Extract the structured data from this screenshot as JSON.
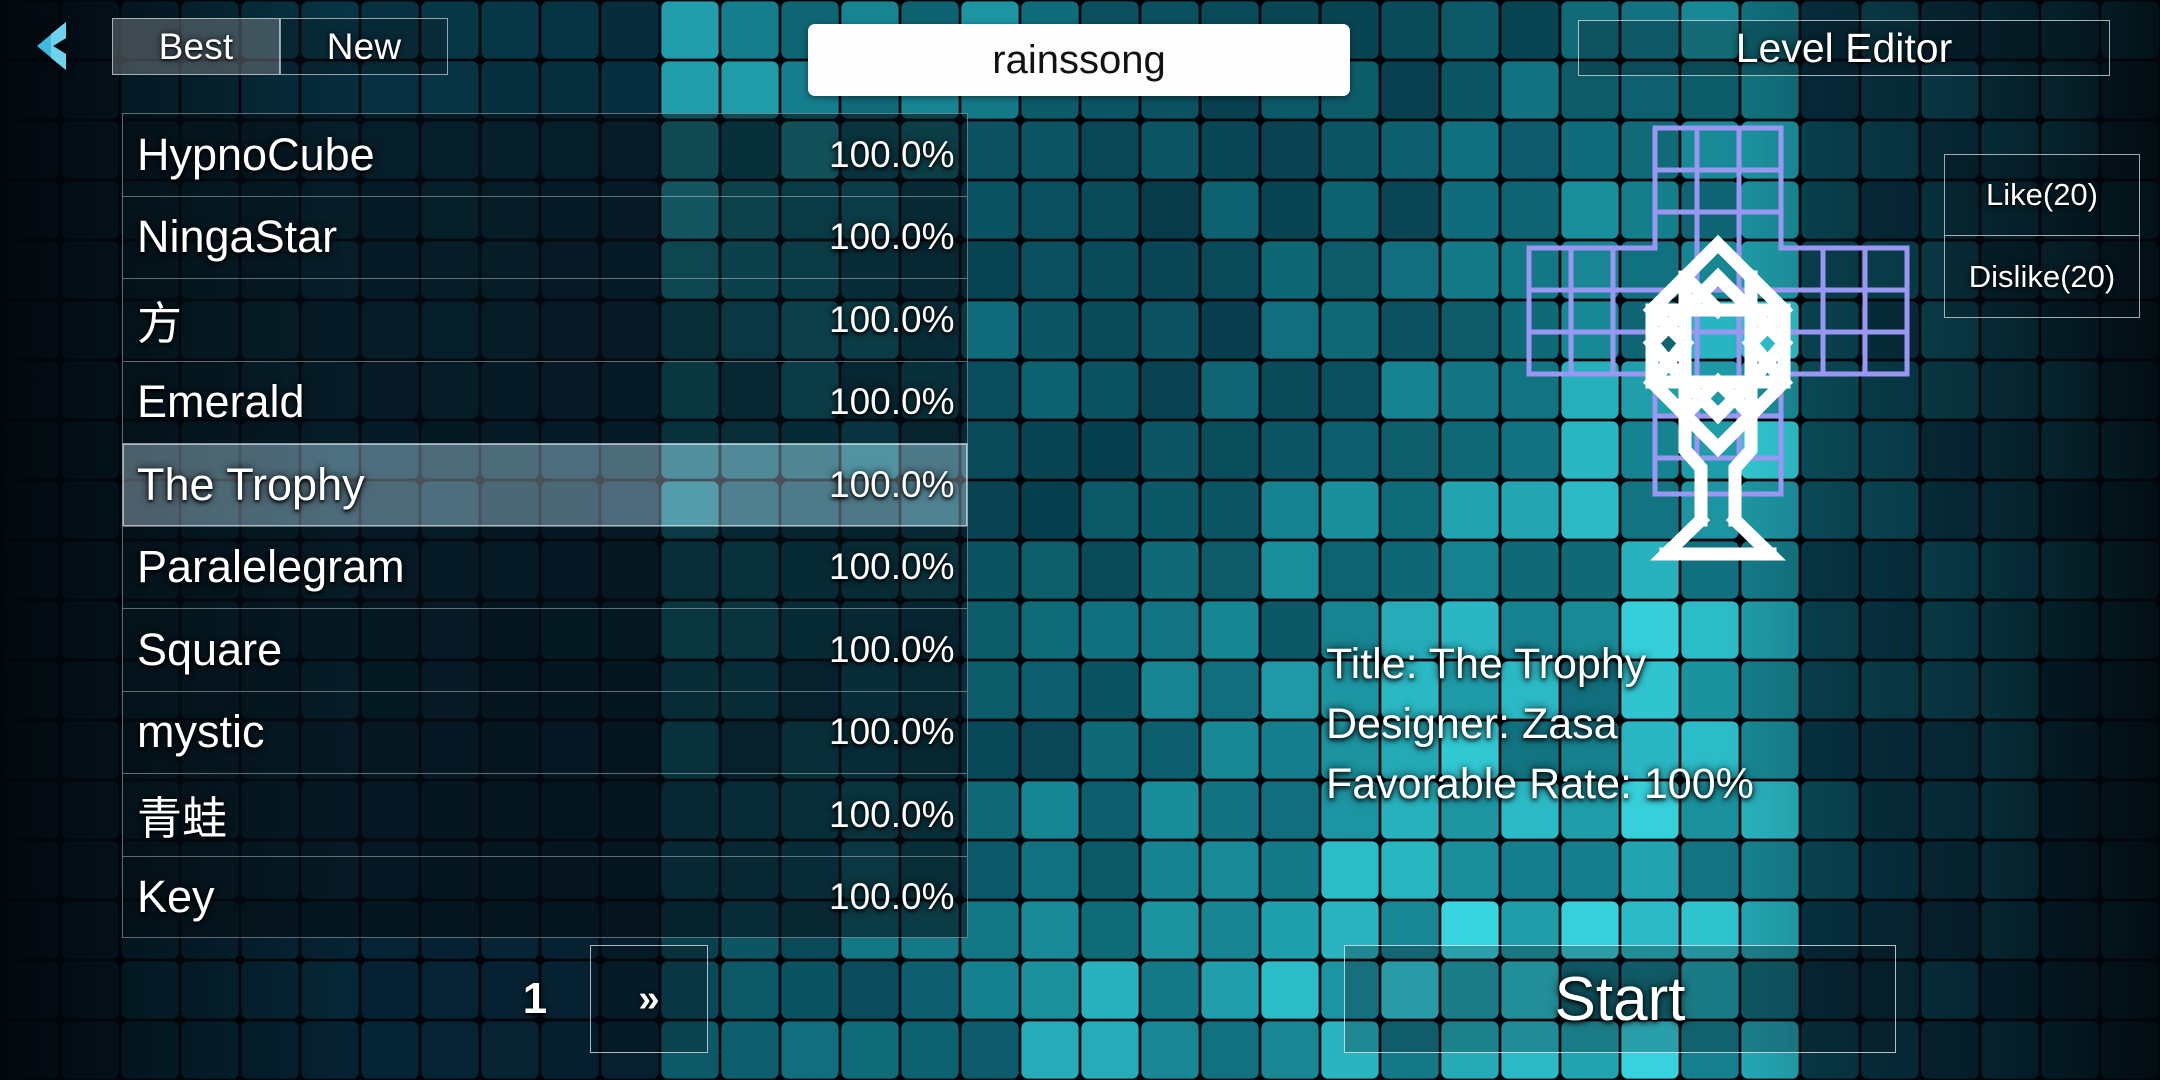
{
  "topbar": {
    "back_icon": "chevron-left-icon",
    "tabs": [
      {
        "label": "Best",
        "selected": true
      },
      {
        "label": "New",
        "selected": false
      }
    ],
    "search": {
      "value": "rainssong",
      "placeholder": ""
    },
    "level_editor_label": "Level Editor"
  },
  "level_list": {
    "rows": [
      {
        "name": "HypnoCube",
        "rate": "100.0%",
        "selected": false
      },
      {
        "name": "NingaStar",
        "rate": "100.0%",
        "selected": false
      },
      {
        "name": "方",
        "rate": "100.0%",
        "selected": false
      },
      {
        "name": "Emerald",
        "rate": "100.0%",
        "selected": false
      },
      {
        "name": "The Trophy",
        "rate": "100.0%",
        "selected": true
      },
      {
        "name": "Paralelegram",
        "rate": "100.0%",
        "selected": false
      },
      {
        "name": "Square",
        "rate": "100.0%",
        "selected": false
      },
      {
        "name": "mystic",
        "rate": "100.0%",
        "selected": false
      },
      {
        "name": "青蛙",
        "rate": "100.0%",
        "selected": false
      },
      {
        "name": "Key",
        "rate": "100.0%",
        "selected": false
      }
    ]
  },
  "pagination": {
    "page_number": "1",
    "next_label": "»"
  },
  "vote": {
    "like_label": "Like(20)",
    "dislike_label": "Dislike(20)"
  },
  "preview": {
    "grid_color": "#9a97f2",
    "shape_color": "#ffffff",
    "description": "cross-shaped puzzle grid with white trophy line-art overlay"
  },
  "info": {
    "title_line": "Title: The Trophy",
    "designer_line": "Designer: Zasa",
    "rate_line": "Favorable Rate: 100%"
  },
  "actions": {
    "start_label": "Start"
  },
  "theme": {
    "accent_cyan": "#2bb7d6",
    "back_arrow_color": "#3fb8dd",
    "panel_border": "#e4eaf0",
    "highlight_row": "#d6e8f5",
    "background_dark": "#04080e"
  }
}
